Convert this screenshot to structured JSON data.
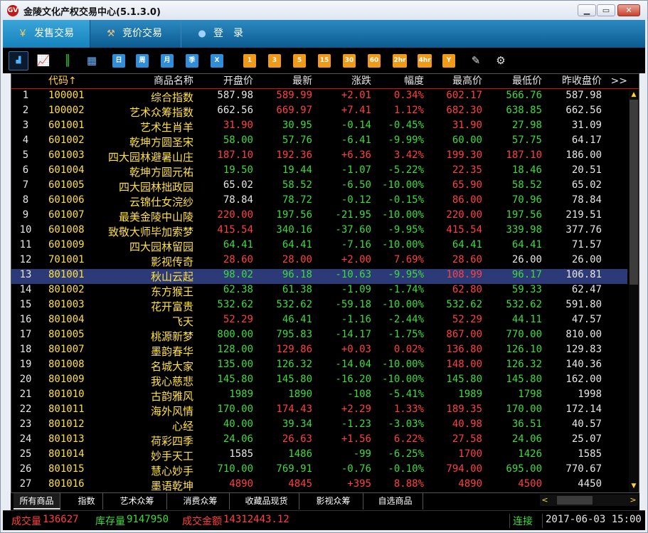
{
  "window": {
    "title": "金陵文化产权交易中心(5.1.3.0)",
    "icon_text": "GV",
    "min": "▁",
    "max": "▭",
    "close": "✕"
  },
  "nav": {
    "tabs": [
      {
        "label": "发售交易",
        "icon": "yen-icon",
        "glyph": "￥"
      },
      {
        "label": "竞价交易",
        "icon": "gavel-icon",
        "glyph": "⚒"
      },
      {
        "label": "登　录",
        "icon": "user-icon",
        "glyph": "●"
      }
    ]
  },
  "toolbar": {
    "buttons": [
      {
        "name": "bar-chart-icon",
        "label": "▟",
        "style": "sel"
      },
      {
        "name": "line-chart-icon",
        "label": "📈",
        "style": "icon"
      },
      {
        "name": "candlestick-icon",
        "label": "║",
        "style": "icon"
      },
      {
        "name": "calendar-icon",
        "label": "▦",
        "style": "icon"
      },
      {
        "name": "period-day",
        "label": "日",
        "style": "blue"
      },
      {
        "name": "period-week",
        "label": "周",
        "style": "blue"
      },
      {
        "name": "period-month",
        "label": "月",
        "style": "blue"
      },
      {
        "name": "period-quarter",
        "label": "季",
        "style": "blue"
      },
      {
        "name": "period-x",
        "label": "X",
        "style": "blue"
      },
      {
        "name": "period-1",
        "label": "1",
        "style": "orange"
      },
      {
        "name": "period-3",
        "label": "3",
        "style": "orange"
      },
      {
        "name": "period-5",
        "label": "5",
        "style": "orange"
      },
      {
        "name": "period-15",
        "label": "15",
        "style": "orange"
      },
      {
        "name": "period-30",
        "label": "30",
        "style": "orange"
      },
      {
        "name": "period-60",
        "label": "60",
        "style": "orange"
      },
      {
        "name": "period-2hr",
        "label": "2hr",
        "style": "orange"
      },
      {
        "name": "period-4hr",
        "label": "4hr",
        "style": "orange"
      },
      {
        "name": "period-year",
        "label": "Y",
        "style": "orange"
      },
      {
        "name": "pencil-icon",
        "label": "✎",
        "style": "icon"
      },
      {
        "name": "gear-icon",
        "label": "⚙",
        "style": "icon"
      }
    ]
  },
  "table": {
    "headers": {
      "code": "代码↑",
      "name": "商品名称",
      "open": "开盘价",
      "last": "最新",
      "chg": "涨跌",
      "pct": "幅度",
      "high": "最高价",
      "low": "最低价",
      "prev": "昨收盘价",
      "more": ">>"
    },
    "selected_index": 13,
    "colors": {
      "up": "#ff4040",
      "down": "#3cdc3c",
      "flat": "#e6e6e6"
    },
    "rows": [
      {
        "i": "1",
        "code": "100001",
        "name": "综合指数",
        "open": "587.98",
        "last": "589.99",
        "chg": "+2.01",
        "pct": "0.34%",
        "high": "602.17",
        "low": "566.76",
        "prev": "587.98"
      },
      {
        "i": "2",
        "code": "100002",
        "name": "艺术众筹指数",
        "open": "662.56",
        "last": "669.97",
        "chg": "+7.41",
        "pct": "1.12%",
        "high": "682.30",
        "low": "638.85",
        "prev": "662.56"
      },
      {
        "i": "3",
        "code": "601001",
        "name": "艺术生肖羊",
        "open": "31.90",
        "last": "30.95",
        "chg": "-0.14",
        "pct": "-0.45%",
        "high": "31.90",
        "low": "27.98",
        "prev": "31.09"
      },
      {
        "i": "4",
        "code": "601002",
        "name": "乾坤方圆圣宋",
        "open": "58.00",
        "last": "57.76",
        "chg": "-6.41",
        "pct": "-9.99%",
        "high": "60.00",
        "low": "57.75",
        "prev": "64.17"
      },
      {
        "i": "5",
        "code": "601003",
        "name": "四大园林避暑山庄",
        "open": "187.10",
        "last": "192.36",
        "chg": "+6.36",
        "pct": "3.42%",
        "high": "199.30",
        "low": "187.10",
        "prev": "186.00"
      },
      {
        "i": "6",
        "code": "601004",
        "name": "乾坤方圆元祐",
        "open": "19.50",
        "last": "19.44",
        "chg": "-1.07",
        "pct": "-5.22%",
        "high": "22.35",
        "low": "18.46",
        "prev": "20.51"
      },
      {
        "i": "7",
        "code": "601005",
        "name": "四大园林拙政园",
        "open": "65.02",
        "last": "58.52",
        "chg": "-6.50",
        "pct": "-10.00%",
        "high": "65.90",
        "low": "58.52",
        "prev": "65.02"
      },
      {
        "i": "8",
        "code": "601006",
        "name": "云锦仕女浣纱",
        "open": "78.84",
        "last": "78.72",
        "chg": "-0.12",
        "pct": "-0.15%",
        "high": "86.00",
        "low": "70.96",
        "prev": "78.84"
      },
      {
        "i": "9",
        "code": "601007",
        "name": "最美金陵中山陵",
        "open": "220.00",
        "last": "197.56",
        "chg": "-21.95",
        "pct": "-10.00%",
        "high": "220.00",
        "low": "197.56",
        "prev": "219.51"
      },
      {
        "i": "10",
        "code": "601008",
        "name": "致敬大师毕加索梦",
        "open": "415.54",
        "last": "340.16",
        "chg": "-37.60",
        "pct": "-9.95%",
        "high": "415.54",
        "low": "339.98",
        "prev": "377.76"
      },
      {
        "i": "11",
        "code": "601009",
        "name": "四大园林留园",
        "open": "64.41",
        "last": "64.41",
        "chg": "-7.16",
        "pct": "-10.00%",
        "high": "64.41",
        "low": "64.41",
        "prev": "71.57"
      },
      {
        "i": "12",
        "code": "701001",
        "name": "影视传奇",
        "open": "28.60",
        "last": "28.00",
        "chg": "+2.00",
        "pct": "7.69%",
        "high": "28.60",
        "low": "26.00",
        "prev": "26.00"
      },
      {
        "i": "13",
        "code": "801001",
        "name": "秋山云起",
        "open": "98.02",
        "last": "96.18",
        "chg": "-10.63",
        "pct": "-9.95%",
        "high": "108.99",
        "low": "96.17",
        "prev": "106.81"
      },
      {
        "i": "14",
        "code": "801002",
        "name": "东方猴王",
        "open": "62.38",
        "last": "61.38",
        "chg": "-1.09",
        "pct": "-1.74%",
        "high": "62.80",
        "low": "59.33",
        "prev": "62.47"
      },
      {
        "i": "15",
        "code": "801003",
        "name": "花开富贵",
        "open": "532.62",
        "last": "532.62",
        "chg": "-59.18",
        "pct": "-10.00%",
        "high": "532.62",
        "low": "532.62",
        "prev": "591.80"
      },
      {
        "i": "16",
        "code": "801004",
        "name": "飞天",
        "open": "52.29",
        "last": "46.41",
        "chg": "-1.16",
        "pct": "-2.44%",
        "high": "52.29",
        "low": "44.11",
        "prev": "47.57"
      },
      {
        "i": "17",
        "code": "801005",
        "name": "桃源新梦",
        "open": "800.00",
        "last": "795.83",
        "chg": "-14.17",
        "pct": "-1.75%",
        "high": "867.00",
        "low": "770.00",
        "prev": "810.00"
      },
      {
        "i": "18",
        "code": "801007",
        "name": "墨韵春华",
        "open": "128.00",
        "last": "129.86",
        "chg": "+0.03",
        "pct": "0.02%",
        "high": "136.80",
        "low": "126.10",
        "prev": "129.83"
      },
      {
        "i": "19",
        "code": "801008",
        "name": "名城大家",
        "open": "135.00",
        "last": "126.32",
        "chg": "-14.04",
        "pct": "-10.00%",
        "high": "148.00",
        "low": "126.32",
        "prev": "140.36"
      },
      {
        "i": "20",
        "code": "801009",
        "name": "我心慈悲",
        "open": "145.80",
        "last": "145.80",
        "chg": "-16.20",
        "pct": "-10.00%",
        "high": "145.80",
        "low": "145.80",
        "prev": "162.00"
      },
      {
        "i": "21",
        "code": "801010",
        "name": "古韵雅风",
        "open": "1989",
        "last": "1890",
        "chg": "-108",
        "pct": "-5.41%",
        "high": "1989",
        "low": "1798",
        "prev": "1998"
      },
      {
        "i": "22",
        "code": "801011",
        "name": "海外风情",
        "open": "170.00",
        "last": "174.43",
        "chg": "+2.29",
        "pct": "1.33%",
        "high": "189.35",
        "low": "170.00",
        "prev": "172.14"
      },
      {
        "i": "23",
        "code": "801012",
        "name": "心经",
        "open": "40.00",
        "last": "39.34",
        "chg": "-1.23",
        "pct": "-3.03%",
        "high": "40.98",
        "low": "36.51",
        "prev": "40.57"
      },
      {
        "i": "24",
        "code": "801013",
        "name": "荷彩四季",
        "open": "24.06",
        "last": "26.63",
        "chg": "+1.56",
        "pct": "6.22%",
        "high": "27.58",
        "low": "24.06",
        "prev": "25.07"
      },
      {
        "i": "25",
        "code": "801014",
        "name": "妙手天工",
        "open": "1585",
        "last": "1486",
        "chg": "-99",
        "pct": "-6.25%",
        "high": "1700",
        "low": "1426",
        "prev": "1585"
      },
      {
        "i": "26",
        "code": "801015",
        "name": "慧心妙手",
        "open": "710.00",
        "last": "769.91",
        "chg": "-0.76",
        "pct": "-0.10%",
        "high": "794.00",
        "low": "695.00",
        "prev": "770.67"
      },
      {
        "i": "27",
        "code": "801016",
        "name": "墨语乾坤",
        "open": "4890",
        "last": "4845",
        "chg": "+395",
        "pct": "8.88%",
        "high": "4890",
        "low": "4500",
        "prev": "4450"
      }
    ]
  },
  "bottom_tabs": [
    "所有商品",
    "指数",
    "艺术众筹",
    "消费众筹",
    "收藏品现货",
    "影视众筹",
    "自选商品"
  ],
  "scroll": {
    "up": "▲",
    "down": "▼",
    "left": "<",
    "right": ">"
  },
  "status": {
    "volume_label": "成交量",
    "volume": "136627",
    "stock_label": "库存量",
    "stock": "9147950",
    "amount_label": "成交金额",
    "amount": "14312443.12",
    "conn": "连接",
    "datetime": "2017-06-03 15:00"
  }
}
